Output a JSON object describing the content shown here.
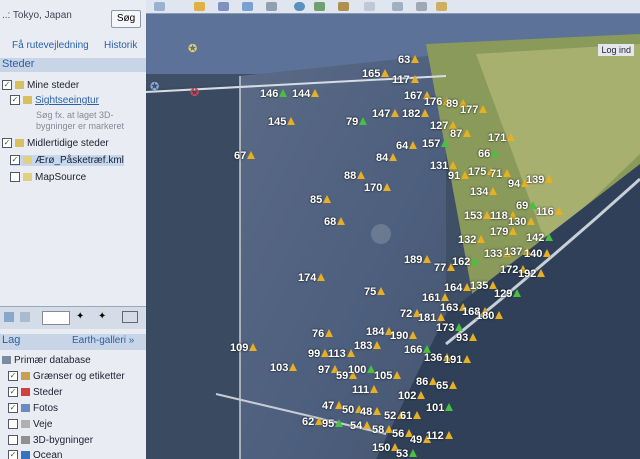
{
  "sidebar": {
    "location_text": "..: Tokyo, Japan",
    "search_button": "Søg",
    "route_link": "Få rutevejledning",
    "history_link": "Historik",
    "places_header": "Steder",
    "my_places": "Mine steder",
    "sightseeing": "Sightseeingtur",
    "sightseeing_desc_1": "Søg fx. at laget 3D-",
    "sightseeing_desc_2": "bygninger er markeret",
    "temp_places": "Midlertidige steder",
    "kml_file": "Ærø_Påsketræf.kml",
    "mapsource": "MapSource",
    "layers_header": "Lag",
    "earth_gallery": "Earth-galleri »",
    "layers": [
      "Primær database",
      "Grænser og etiketter",
      "Steder",
      "Fotos",
      "Veje",
      "3D-bygninger",
      "Ocean"
    ]
  },
  "toolbar": {
    "login": "Log ind"
  },
  "markers": [
    "63",
    "165",
    "117",
    "146",
    "144",
    "167",
    "176",
    "89",
    "177",
    "145",
    "79",
    "147",
    "182",
    "127",
    "87",
    "171",
    "67",
    "157",
    "84",
    "64",
    "131",
    "91",
    "175",
    "71",
    "66",
    "88",
    "170",
    "94",
    "139",
    "134",
    "85",
    "69",
    "116",
    "118",
    "68",
    "153",
    "130",
    "179",
    "142",
    "132",
    "133",
    "137",
    "140",
    "189",
    "77",
    "162",
    "172",
    "192",
    "174",
    "75",
    "164",
    "135",
    "129",
    "161",
    "163",
    "168",
    "72",
    "181",
    "180",
    "173",
    "93",
    "76",
    "184",
    "190",
    "109",
    "183",
    "166",
    "99",
    "113",
    "136",
    "191",
    "97",
    "59",
    "100",
    "103",
    "86",
    "105",
    "65",
    "111",
    "102",
    "101",
    "47",
    "50",
    "48",
    "52",
    "61",
    "62",
    "95",
    "54",
    "58",
    "56",
    "49",
    "112",
    "150",
    "53"
  ]
}
